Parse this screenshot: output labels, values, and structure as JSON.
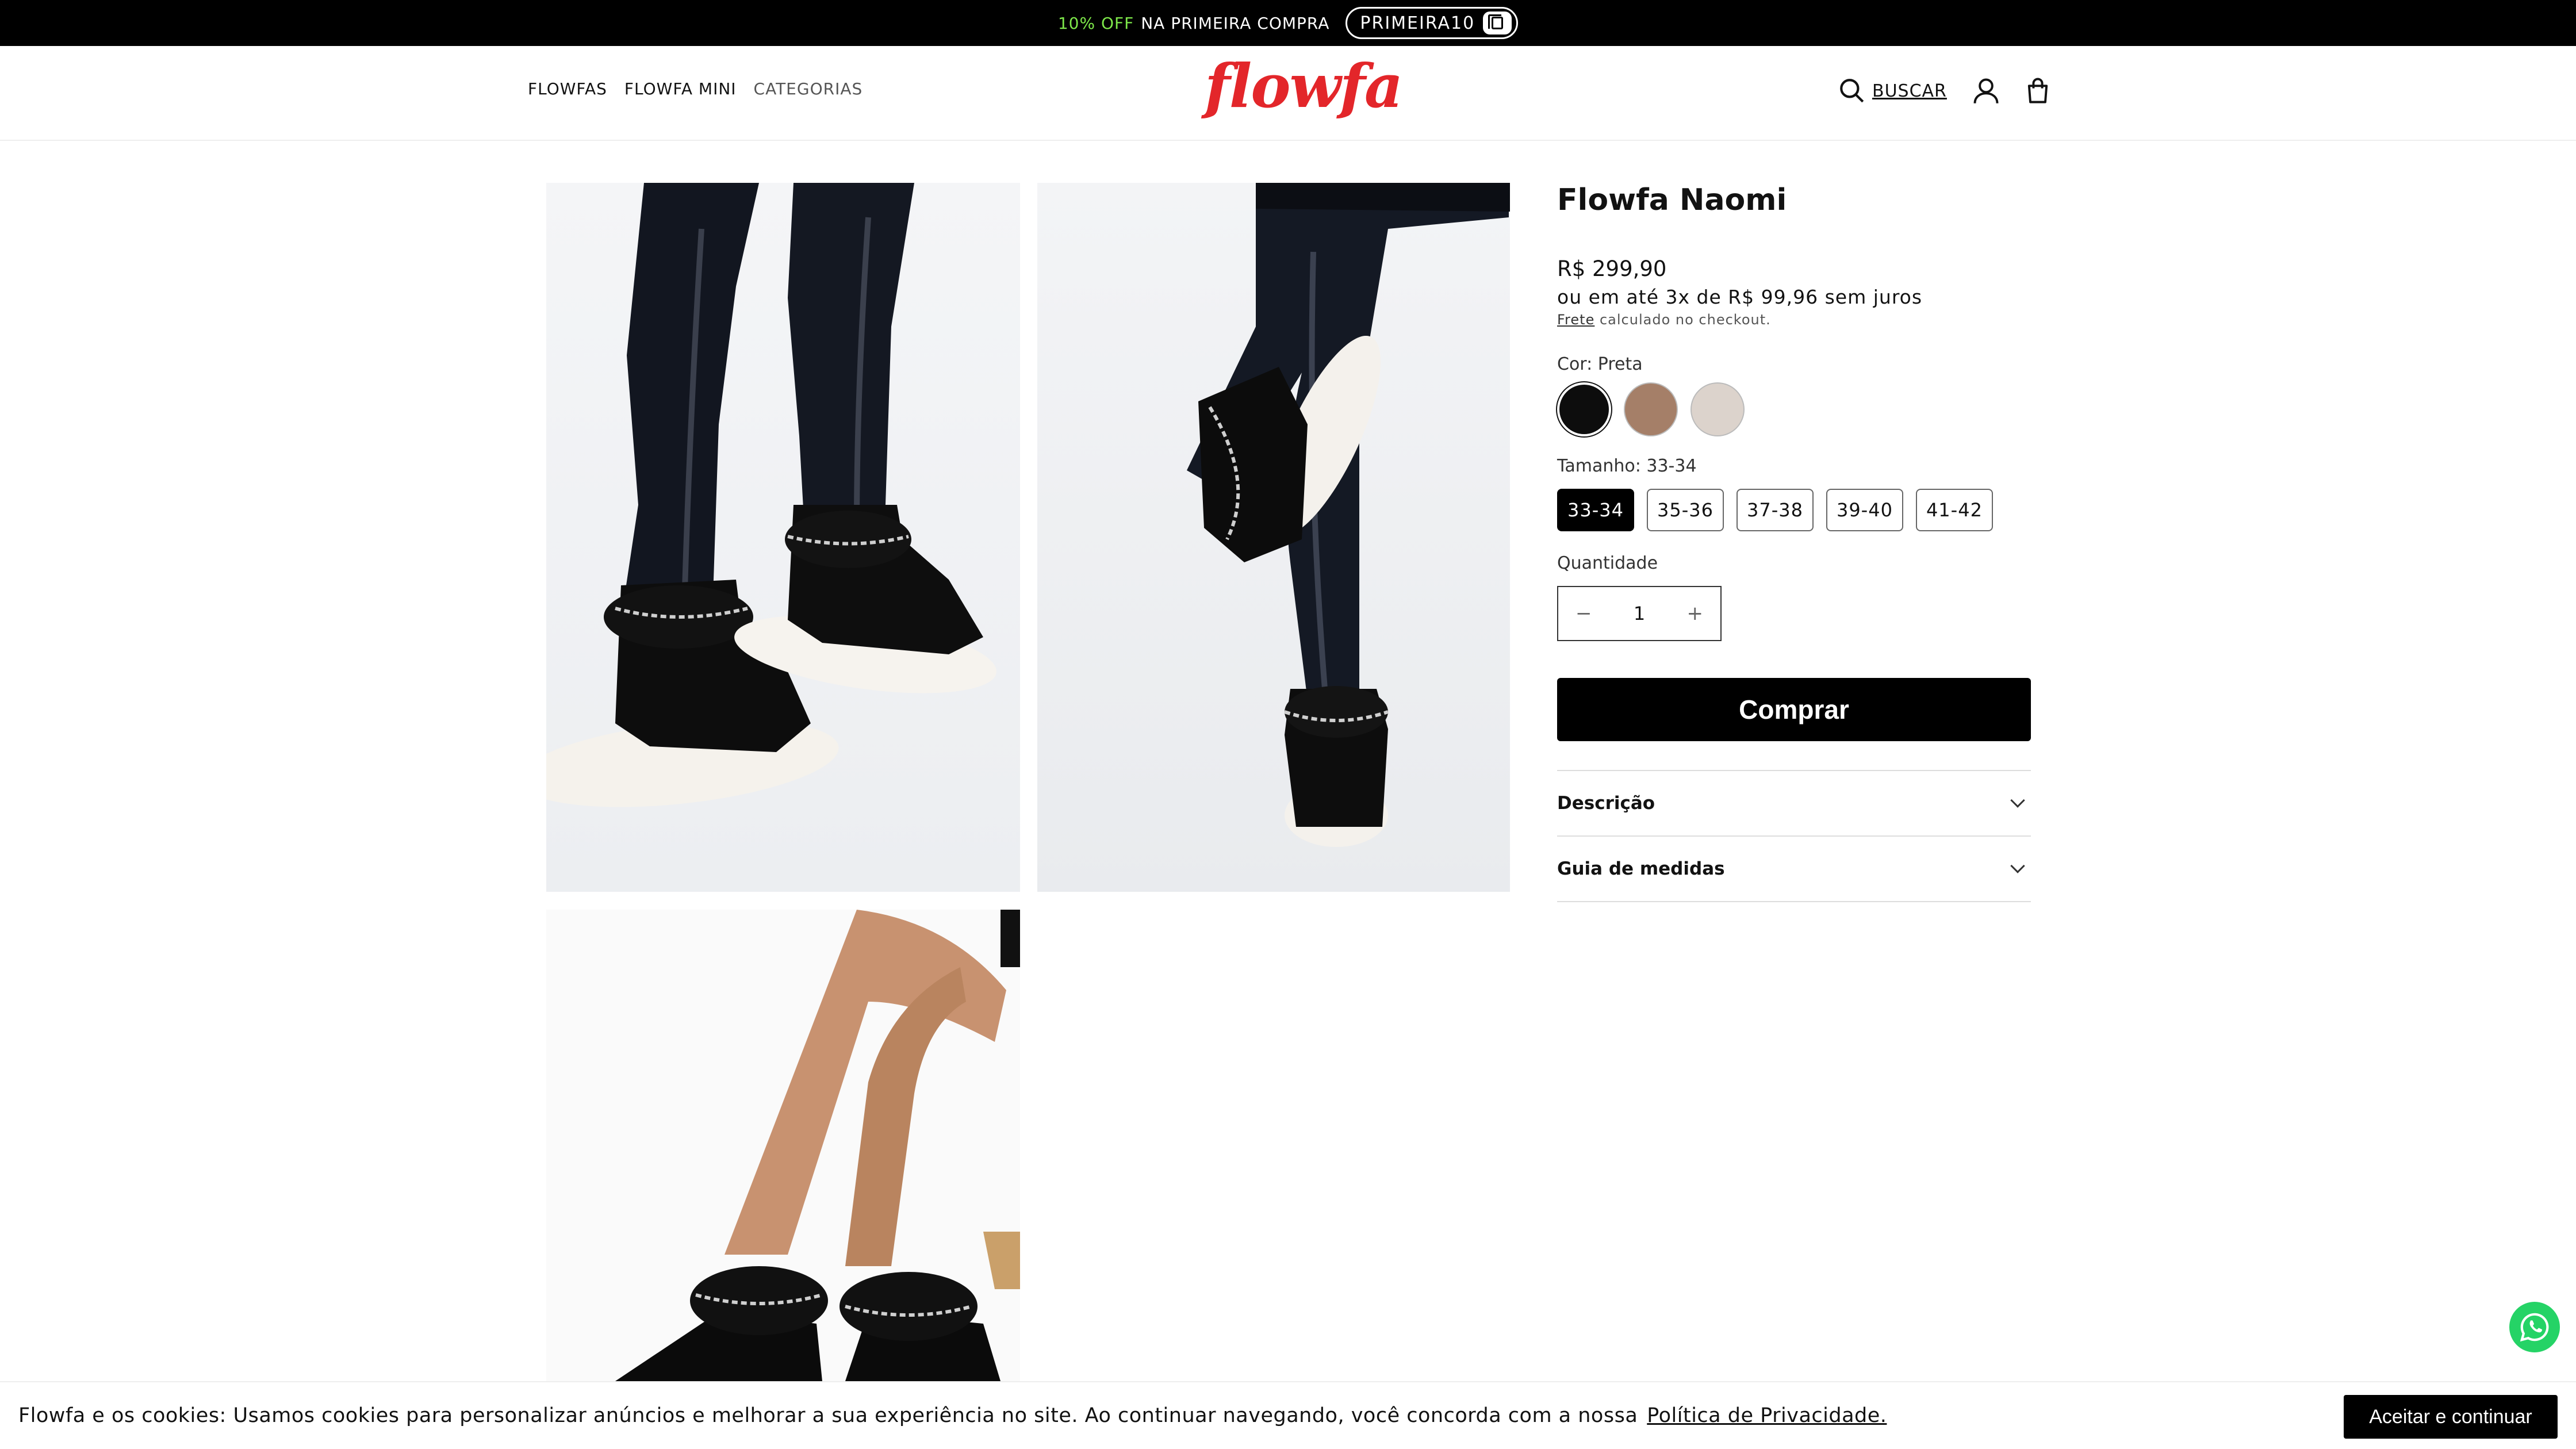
{
  "announcement": {
    "highlight": "10% OFF",
    "text": "NA PRIMEIRA COMPRA",
    "coupon": "PRIMEIRA10",
    "copy_icon": "copy-icon"
  },
  "header": {
    "nav": [
      "FLOWFAS",
      "FLOWFA MINI",
      "CATEGORIAS"
    ],
    "logo": "flowfa",
    "search_label": "BUSCAR",
    "icons": [
      "search-icon",
      "account-icon",
      "cart-icon"
    ]
  },
  "product": {
    "title": "Flowfa Naomi",
    "price": "R$ 299,90",
    "installments": "ou em até 3x de R$ 99,96 sem juros",
    "shipping_link": "Frete",
    "shipping_text": "calculado no checkout.",
    "color_label": "Cor: Preta",
    "colors": [
      {
        "name": "Preta",
        "hex": "#0d0d0d"
      },
      {
        "name": "Caramelo",
        "hex": "#a57f68"
      },
      {
        "name": "Bege",
        "hex": "#dcd3cc"
      }
    ],
    "size_label": "Tamanho: 33-34",
    "sizes": [
      "33-34",
      "35-36",
      "37-38",
      "39-40",
      "41-42"
    ],
    "quantity_label": "Quantidade",
    "quantity": "1",
    "minus": "−",
    "plus": "+",
    "buy_label": "Comprar",
    "accordion": [
      "Descrição",
      "Guia de medidas"
    ]
  },
  "cookie": {
    "text": "Flowfa e os cookies: Usamos cookies para personalizar anúncios e melhorar a sua experiência no site. Ao continuar navegando, você concorda com a nossa",
    "link": "Política de Privacidade.",
    "accept": "Aceitar e continuar"
  },
  "colors": {
    "accent": "#e3262a",
    "announce_bg": "#000000",
    "announce_highlight": "#7ee84a",
    "whatsapp": "#25d366"
  }
}
